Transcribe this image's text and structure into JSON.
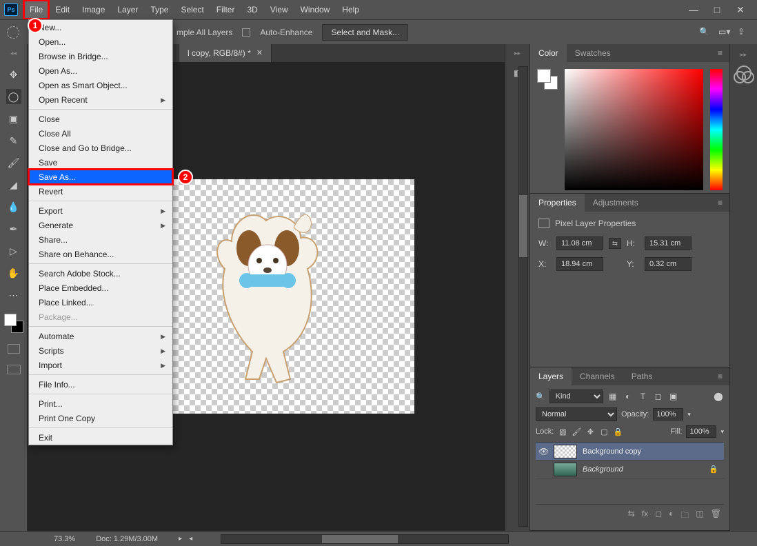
{
  "menubar": {
    "items": [
      "File",
      "Edit",
      "Image",
      "Layer",
      "Type",
      "Select",
      "Filter",
      "3D",
      "View",
      "Window",
      "Help"
    ],
    "open": "File"
  },
  "window_controls": {
    "min": "—",
    "max": "□",
    "close": "✕"
  },
  "callouts": {
    "one": "1",
    "two": "2"
  },
  "options_bar": {
    "sample_label": "mple All Layers",
    "auto_enhance": "Auto-Enhance",
    "select_mask": "Select and Mask..."
  },
  "file_menu": {
    "groups": [
      [
        "New...",
        "Open...",
        "Browse in Bridge...",
        "Open As...",
        "Open as Smart Object...",
        "Open Recent"
      ],
      [
        "Close",
        "Close All",
        "Close and Go to Bridge...",
        "Save",
        "Save As...",
        "Revert"
      ],
      [
        "Export",
        "Generate",
        "Share...",
        "Share on Behance..."
      ],
      [
        "Search Adobe Stock...",
        "Place Embedded...",
        "Place Linked...",
        "Package..."
      ],
      [
        "Automate",
        "Scripts",
        "Import"
      ],
      [
        "File Info..."
      ],
      [
        "Print...",
        "Print One Copy"
      ],
      [
        "Exit"
      ]
    ],
    "submenu_items": [
      "Open Recent",
      "Export",
      "Generate",
      "Automate",
      "Scripts",
      "Import"
    ],
    "disabled": [
      "Package..."
    ],
    "highlighted": "Save As..."
  },
  "doc_tab": {
    "label": "l copy, RGB/8#) *"
  },
  "panels": {
    "color": {
      "tabs": [
        "Color",
        "Swatches"
      ]
    },
    "properties": {
      "tabs": [
        "Properties",
        "Adjustments"
      ],
      "title": "Pixel Layer Properties",
      "w_label": "W:",
      "w": "11.08 cm",
      "h_label": "H:",
      "h": "15.31 cm",
      "x_label": "X:",
      "x": "18.94 cm",
      "y_label": "Y:",
      "y": "0.32 cm"
    },
    "layers": {
      "tabs": [
        "Layers",
        "Channels",
        "Paths"
      ],
      "kind_label": "Kind",
      "blend": "Normal",
      "opacity_label": "Opacity:",
      "opacity": "100%",
      "lock_label": "Lock:",
      "fill_label": "Fill:",
      "fill": "100%",
      "items": [
        {
          "name": "Background copy",
          "sel": true
        },
        {
          "name": "Background",
          "locked": true,
          "italic": true
        }
      ]
    }
  },
  "status": {
    "zoom": "73.3%",
    "doc": "Doc: 1.29M/3.00M"
  }
}
